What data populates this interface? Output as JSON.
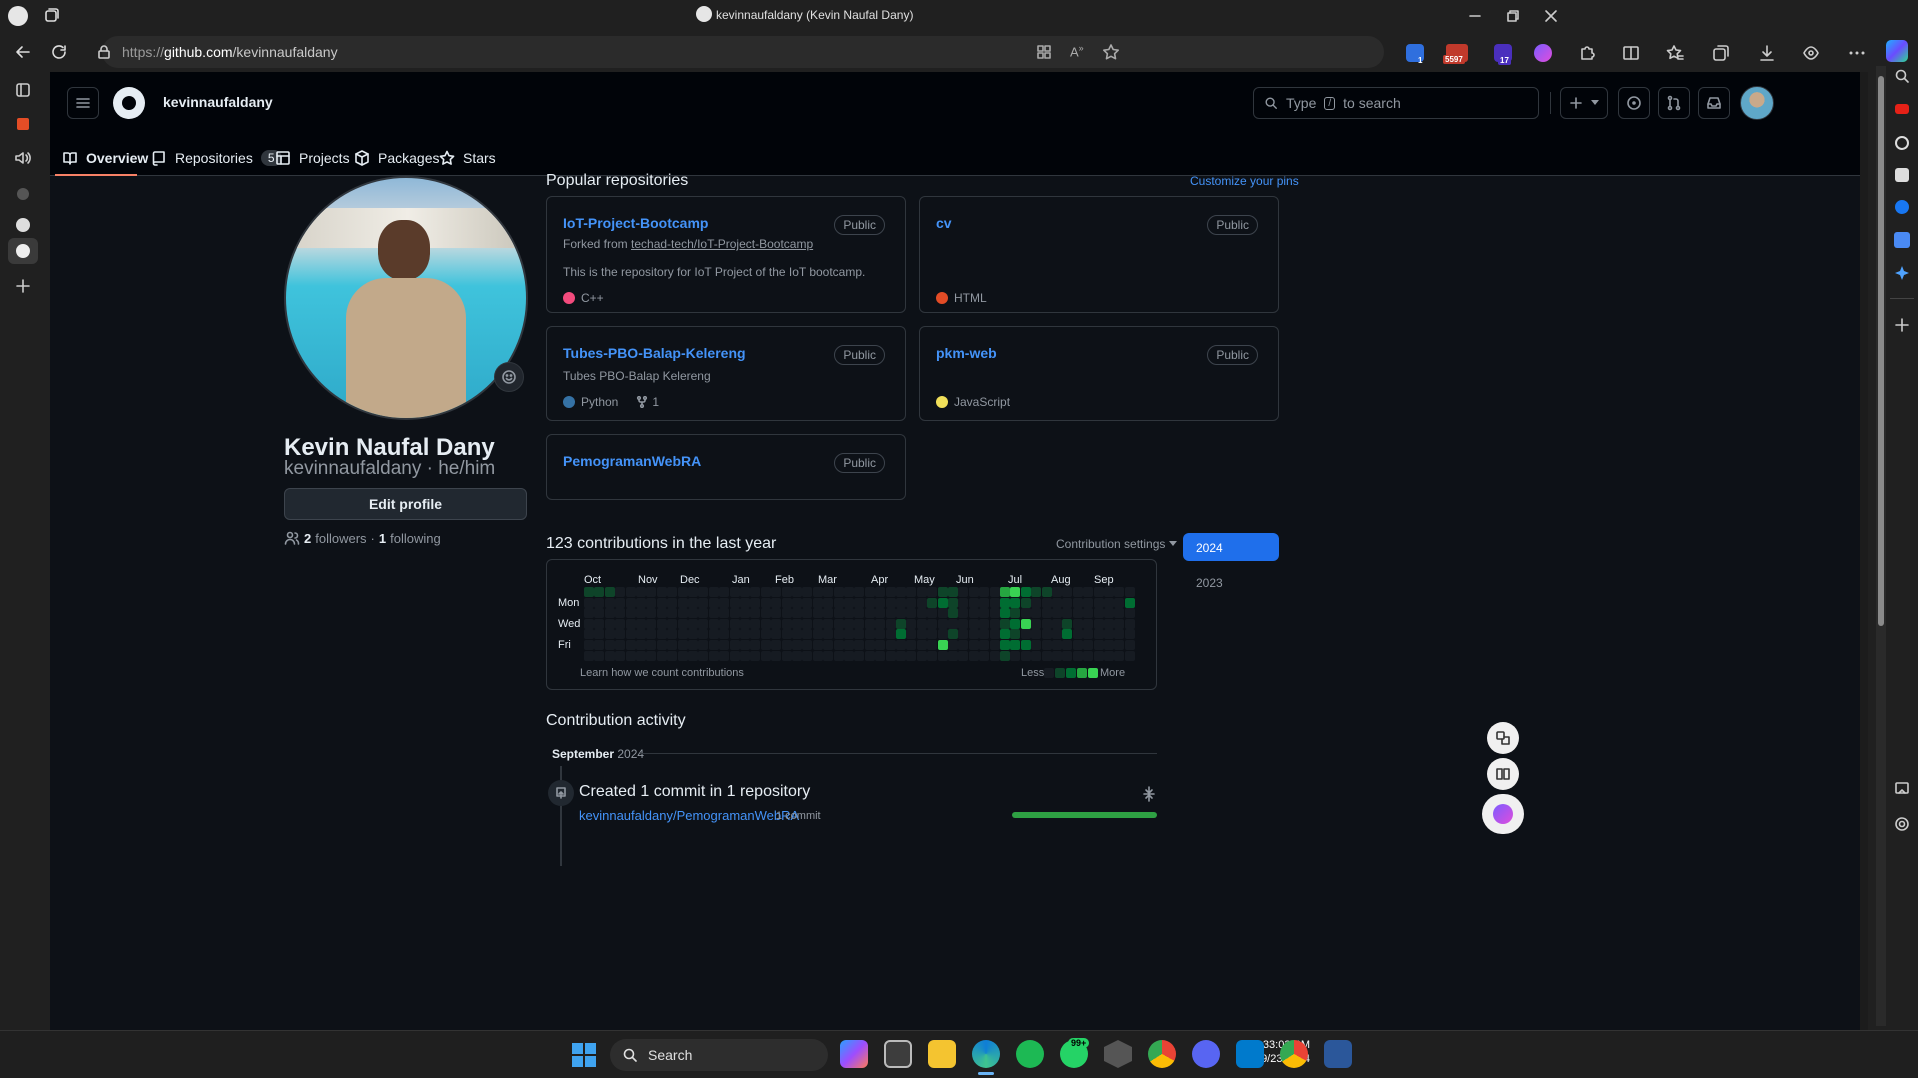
{
  "browser": {
    "tab_title": "kevinnaufaldany (Kevin Naufal Dany)",
    "url_prefix": "https://",
    "url_host": "github.com",
    "url_path": "/kevinnaufaldany",
    "ext_badge_1": "1",
    "ext_badge_mail": "5597",
    "ext_badge_17": "17"
  },
  "github": {
    "username": "kevinnaufaldany",
    "search_before": "Type",
    "search_key": "/",
    "search_after": "to search",
    "tabs": [
      {
        "label": "Overview",
        "icon": "book-icon"
      },
      {
        "label": "Repositories",
        "count": "5",
        "icon": "repo-icon"
      },
      {
        "label": "Projects",
        "icon": "table-icon"
      },
      {
        "label": "Packages",
        "icon": "package-icon"
      },
      {
        "label": "Stars",
        "icon": "star-icon"
      }
    ]
  },
  "profile": {
    "fullname": "Kevin Naufal Dany",
    "login": "kevinnaufaldany",
    "pronouns": "he/him",
    "edit_label": "Edit profile",
    "followers_count": "2",
    "followers_label": "followers",
    "following_count": "1",
    "following_label": "following"
  },
  "popular": {
    "title": "Popular repositories",
    "customize": "Customize your pins",
    "repos": [
      {
        "name": "IoT-Project-Bootcamp",
        "badge": "Public",
        "forked_prefix": "Forked from",
        "forked_link": "techad-tech/IoT-Project-Bootcamp",
        "description": "This is the repository for IoT Project of the IoT bootcamp.",
        "language": "C++",
        "lang_color": "#f34b7d"
      },
      {
        "name": "cv",
        "badge": "Public",
        "language": "HTML",
        "lang_color": "#e34c26"
      },
      {
        "name": "Tubes-PBO-Balap-Kelereng",
        "badge": "Public",
        "description": "Tubes PBO-Balap Kelereng",
        "language": "Python",
        "lang_color": "#3572A5",
        "forks": "1"
      },
      {
        "name": "pkm-web",
        "badge": "Public",
        "language": "JavaScript",
        "lang_color": "#f1e05a"
      },
      {
        "name": "PemogramanWebRA",
        "badge": "Public"
      }
    ]
  },
  "contributions": {
    "title": "123 contributions in the last year",
    "settings": "Contribution settings",
    "months": [
      "Oct",
      "Nov",
      "Dec",
      "Jan",
      "Feb",
      "Mar",
      "Apr",
      "May",
      "Jun",
      "Jul",
      "Aug",
      "Sep"
    ],
    "days": [
      "Mon",
      "Wed",
      "Fri"
    ],
    "learn": "Learn how we count contributions",
    "less": "Less",
    "more": "More",
    "years": [
      "2024",
      "2023"
    ],
    "level_colors": [
      "#161b22",
      "#0e4429",
      "#006d32",
      "#26a641",
      "#39d353"
    ]
  },
  "activity": {
    "title": "Contribution activity",
    "month": "September",
    "year": "2024",
    "event": "Created 1 commit in 1 repository",
    "repo_link": "kevinnaufaldany/PemogramanWebRA",
    "commits": "1 commit",
    "progress": 1.0
  },
  "taskbar": {
    "search_label": "Search",
    "whatsapp_badge": "99+",
    "time": "10:33:03 PM",
    "date": "9/23/2024"
  }
}
